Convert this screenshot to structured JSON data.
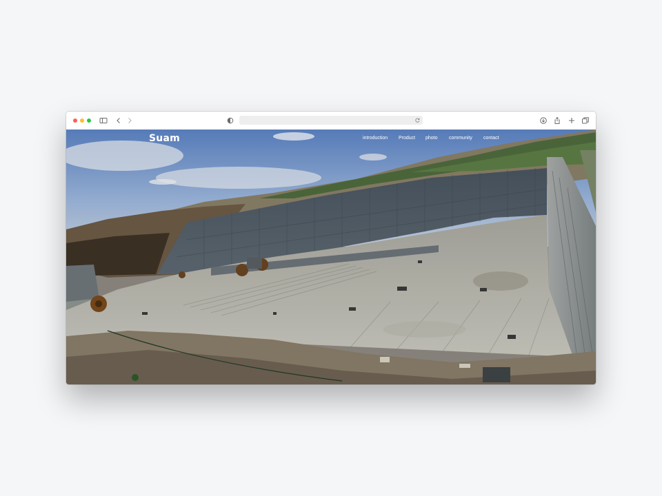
{
  "browser": {
    "url": "",
    "icons": {
      "sidebar": "sidebar-icon",
      "back": "back-arrow-icon",
      "forward": "forward-arrow-icon",
      "privacy": "privacy-shield-icon",
      "reload": "reload-icon",
      "download": "download-icon",
      "share": "share-icon",
      "new_tab": "plus-icon",
      "tabs": "tab-overview-icon"
    }
  },
  "site": {
    "logo": "Suam",
    "nav": [
      "introduction",
      "Product",
      "photo",
      "community",
      "contact"
    ],
    "hero_image": "quarry-photo"
  },
  "colors": {
    "traffic_red": "#fe5f57",
    "traffic_yellow": "#febc2e",
    "traffic_green": "#28c840"
  }
}
